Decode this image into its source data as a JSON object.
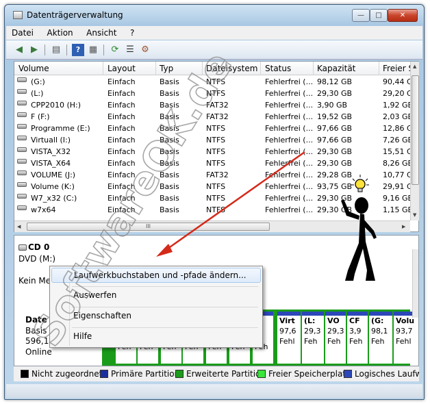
{
  "window": {
    "title": "Datenträgerverwaltung",
    "buttons": {
      "minimize": "—",
      "maximize": "□",
      "close": "✕"
    }
  },
  "menu": [
    "Datei",
    "Aktion",
    "Ansicht",
    "?"
  ],
  "toolbar": [
    "back-icon",
    "forward-icon",
    "list-view-icon",
    "help-icon",
    "properties-view-icon",
    "refresh-icon",
    "properties-icon",
    "rescan-icon"
  ],
  "table": {
    "columns": [
      "Volume",
      "Layout",
      "Typ",
      "Dateisystem",
      "Status",
      "Kapazität",
      "Freier S"
    ],
    "rows": [
      [
        "(G:)",
        "Einfach",
        "Basis",
        "NTFS",
        "Fehlerfrei (...",
        "98,12 GB",
        "90,44 G"
      ],
      [
        "(L:)",
        "Einfach",
        "Basis",
        "NTFS",
        "Fehlerfrei (...",
        "29,30 GB",
        "29,20 G"
      ],
      [
        "CPP2010 (H:)",
        "Einfach",
        "Basis",
        "FAT32",
        "Fehlerfrei (...",
        "3,90 GB",
        "1,92 GB"
      ],
      [
        "F (F:)",
        "Einfach",
        "Basis",
        "FAT32",
        "Fehlerfrei (...",
        "19,52 GB",
        "2,03 GB"
      ],
      [
        "Programme (E:)",
        "Einfach",
        "Basis",
        "NTFS",
        "Fehlerfrei (...",
        "97,66 GB",
        "12,86 G"
      ],
      [
        "Virtuall (I:)",
        "Einfach",
        "Basis",
        "NTFS",
        "Fehlerfrei (...",
        "97,66 GB",
        "7,26 GB"
      ],
      [
        "VISTA_X32",
        "Einfach",
        "Basis",
        "NTFS",
        "Fehlerfrei (...",
        "29,30 GB",
        "15,51 G"
      ],
      [
        "VISTA_X64",
        "Einfach",
        "Basis",
        "NTFS",
        "Fehlerfrei (...",
        "29,30 GB",
        "8,26 GB"
      ],
      [
        "VOLUME (J:)",
        "Einfach",
        "Basis",
        "FAT32",
        "Fehlerfrei (...",
        "29,28 GB",
        "10,77 G"
      ],
      [
        "Volume (K:)",
        "Einfach",
        "Basis",
        "NTFS",
        "Fehlerfrei (...",
        "93,75 GB",
        "29,91 G"
      ],
      [
        "W7_x32 (C:)",
        "Einfach",
        "Basis",
        "NTFS",
        "Fehlerfrei (...",
        "29,30 GB",
        "9,16 GB"
      ],
      [
        "w7x64",
        "Einfach",
        "Basis",
        "NTFS",
        "Fehlerfrei (...",
        "29,30 GB",
        "1,15 GB"
      ]
    ]
  },
  "cd": {
    "name": "CD 0",
    "type": "DVD (M:)",
    "media": "Kein Me"
  },
  "disk": {
    "name": "Date",
    "type": "Basis",
    "size": "596,17 G",
    "state": "Online"
  },
  "partitions_top": [
    {
      "name": "Virt",
      "size": "97,6",
      "status": "Fehl"
    },
    {
      "name": "(L:",
      "size": "29,3",
      "status": "Feh"
    },
    {
      "name": "VO",
      "size": "29,3",
      "status": "Feh"
    },
    {
      "name": "CF",
      "size": "3,9",
      "status": "Feh"
    },
    {
      "name": "(G:",
      "size": "98,1",
      "status": "Feh"
    },
    {
      "name": "Volu",
      "size": "93,7",
      "status": "Fehl"
    }
  ],
  "partitions_bottom": [
    "Fen",
    "Fen",
    "Fen",
    "Fen",
    "Fen",
    "Feh",
    "Feh"
  ],
  "context_menu": {
    "items": [
      "Laufwerkbuchstaben und -pfade ändern...",
      "Auswerfen",
      "Eigenschaften",
      "Hilfe"
    ]
  },
  "legend": [
    {
      "label": "Nicht zugeordnet",
      "color": "#000000"
    },
    {
      "label": "Primäre Partition",
      "color": "#1b2f9c"
    },
    {
      "label": "Erweiterte Partition",
      "color": "#1a9c1a"
    },
    {
      "label": "Freier Speicherplatz",
      "color": "#39e639"
    },
    {
      "label": "Logisches Laufwerk",
      "color": "#2b47b8"
    }
  ],
  "watermark": "SoftwareOK.de",
  "colors": {
    "arrow": "#d42a1a",
    "bulb": "#ffe23a"
  }
}
